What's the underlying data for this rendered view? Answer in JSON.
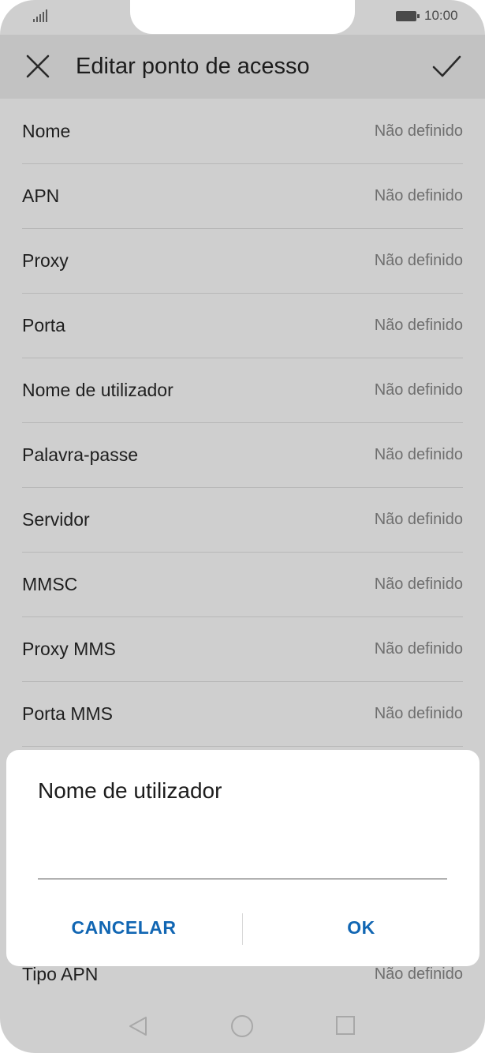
{
  "status_bar": {
    "time": "10:00"
  },
  "app_bar": {
    "title": "Editar ponto de acesso",
    "close_icon": "close-icon",
    "confirm_icon": "check-icon"
  },
  "fields": [
    {
      "label": "Nome",
      "value": "Não definido"
    },
    {
      "label": "APN",
      "value": "Não definido"
    },
    {
      "label": "Proxy",
      "value": "Não definido"
    },
    {
      "label": "Porta",
      "value": "Não definido"
    },
    {
      "label": "Nome de utilizador",
      "value": "Não definido"
    },
    {
      "label": "Palavra-passe",
      "value": "Não definido"
    },
    {
      "label": "Servidor",
      "value": "Não definido"
    },
    {
      "label": "MMSC",
      "value": "Não definido"
    },
    {
      "label": "Proxy MMS",
      "value": "Não definido"
    },
    {
      "label": "Porta MMS",
      "value": "Não definido"
    }
  ],
  "tipo_apn": {
    "label": "Tipo APN",
    "value": "Não definido"
  },
  "dialog": {
    "title": "Nome de utilizador",
    "input_value": "",
    "cancel_label": "CANCELAR",
    "ok_label": "OK"
  },
  "colors": {
    "accent": "#1166b3",
    "overlay": "#cfcfcf"
  }
}
